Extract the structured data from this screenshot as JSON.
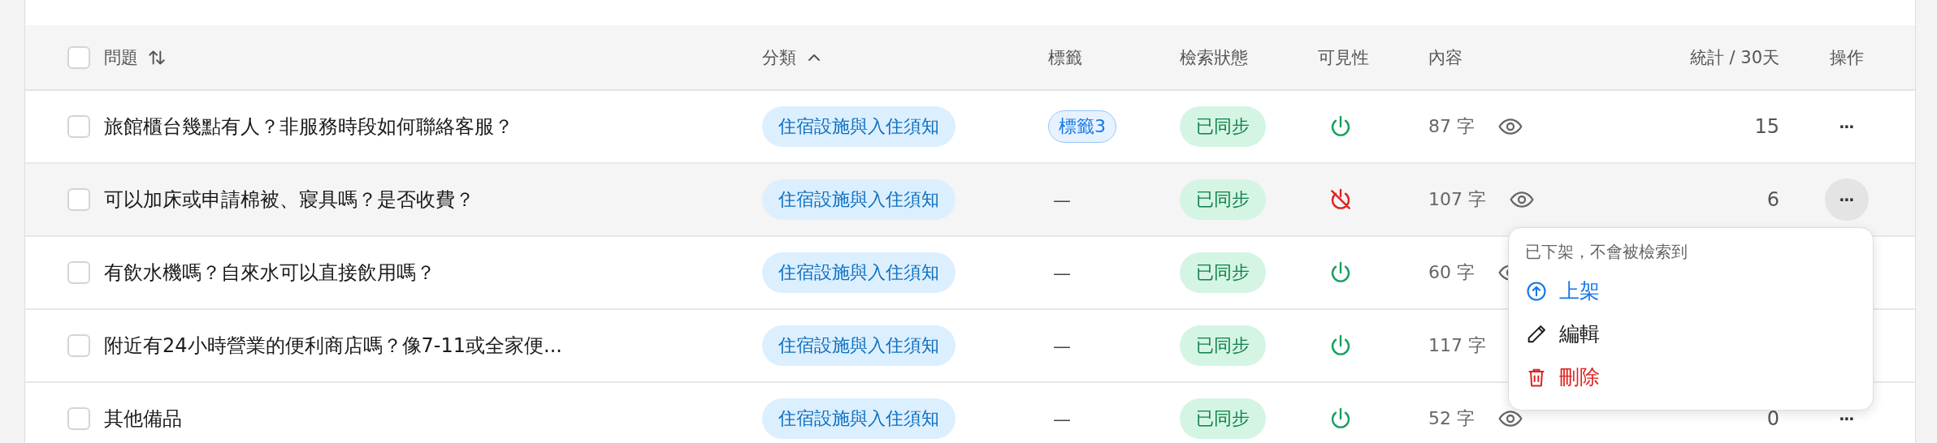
{
  "table": {
    "select_all": {
      "checked": false
    },
    "columns": [
      {
        "label": "問題",
        "kind": "sortable"
      },
      {
        "label": "分類",
        "kind": "ascending"
      },
      {
        "label": "標籤",
        "kind": "plain"
      },
      {
        "label": "檢索狀態",
        "kind": "plain"
      },
      {
        "label": "可見性",
        "kind": "plain"
      },
      {
        "label": "內容",
        "kind": "plain"
      },
      {
        "label": "統計 / 30天",
        "kind": "plain"
      },
      {
        "label": "操作",
        "kind": "plain"
      }
    ],
    "rows": [
      {
        "checked": false,
        "active": false,
        "question": "旅館櫃台幾點有人？非服務時段如何聯絡客服？",
        "category": "住宿設施與入住須知",
        "tag": {
          "kind": "pill",
          "text": "標籤3"
        },
        "status": "已同步",
        "visible": true,
        "content": "87 字",
        "stats": "15",
        "actions": "···"
      },
      {
        "checked": false,
        "active": true,
        "question": "可以加床或申請棉被、寢具嗎？是否收費？",
        "category": "住宿設施與入住須知",
        "tag": {
          "kind": "dash",
          "text": "—"
        },
        "status": "已同步",
        "visible": false,
        "content": "107 字",
        "stats": "6",
        "actions": "···"
      },
      {
        "checked": false,
        "active": false,
        "question": "有飲水機嗎？自來水可以直接飲用嗎？",
        "category": "住宿設施與入住須知",
        "tag": {
          "kind": "dash",
          "text": "—"
        },
        "status": "已同步",
        "visible": true,
        "content": "60 字"
      },
      {
        "checked": false,
        "active": false,
        "question": "附近有24小時營業的便利商店嗎？像7-11或全家便...",
        "category": "住宿設施與入住須知",
        "tag": {
          "kind": "dash",
          "text": "—"
        },
        "status": "已同步",
        "visible": true,
        "content": "117 字"
      },
      {
        "checked": false,
        "active": false,
        "question": "其他備品",
        "category": "住宿設施與入住須知",
        "tag": {
          "kind": "dash",
          "text": "—"
        },
        "status": "已同步",
        "visible": true,
        "content": "52 字",
        "stats": "0",
        "actions": "···"
      }
    ]
  },
  "row_menu": {
    "note": "已下架，不會被檢索到",
    "items": [
      {
        "kind": "publish",
        "label": "上架"
      },
      {
        "kind": "edit",
        "label": "編輯"
      },
      {
        "kind": "delete",
        "label": "刪除"
      }
    ]
  }
}
